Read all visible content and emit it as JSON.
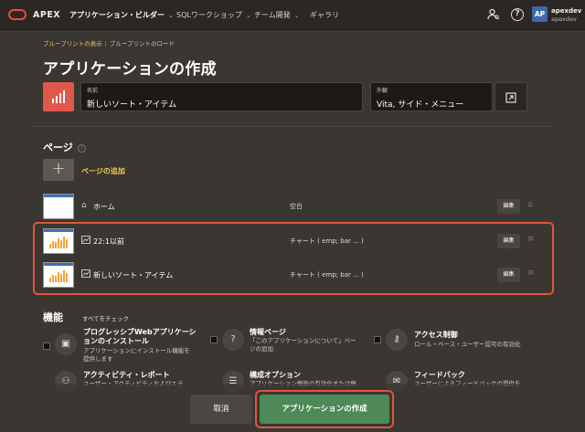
{
  "topbar": {
    "brand": "APEX",
    "nav": [
      {
        "label": "アプリケーション・ビルダー",
        "active": true
      },
      {
        "label": "SQLワークショップ",
        "active": false
      },
      {
        "label": "チーム開発",
        "active": false
      },
      {
        "label": "ギャラリ",
        "active": false
      }
    ],
    "user": {
      "initials": "AP",
      "name": "apexdev",
      "workspace": "apexdev"
    }
  },
  "breadcrumb": {
    "link": "ブループリントの表示",
    "current": "ブループリントのロード"
  },
  "page_title": "アプリケーションの作成",
  "name_field": {
    "label": "名前",
    "value": "新しいソート・アイテム"
  },
  "appearance_field": {
    "label": "外観",
    "value": "Vita, サイド・メニュー"
  },
  "pages": {
    "title": "ページ",
    "add_label": "ページの追加",
    "rows": [
      {
        "icon": "home-icon",
        "name": "ホーム",
        "type": "空白",
        "edit": "編集"
      },
      {
        "icon": "chart-icon",
        "name": "22:1以前",
        "type": "チャート ( emp; bar ... )",
        "edit": "編集"
      },
      {
        "icon": "chart-icon",
        "name": "新しいソート・アイテム",
        "type": "チャート ( emp; bar ... )",
        "edit": "編集"
      }
    ]
  },
  "features": {
    "title": "機能",
    "check_all": "すべてをチェック",
    "items": [
      {
        "title1": "プログレッシブWebアプリケーシ",
        "title2": "ョンのインストール",
        "desc1": "アプリケーションにインストール機能を",
        "desc2": "提供します"
      },
      {
        "title1": "情報ページ",
        "title2": "",
        "desc1": "「このアプリケーションについて」ペー",
        "desc2": "ジの追加"
      },
      {
        "title1": "アクセス制御",
        "title2": "",
        "desc1": "ロール・ベース・ユーザー認可の有効化",
        "desc2": ""
      },
      {
        "title1": "アクティビティ・レポート",
        "title2": "",
        "desc1": "ユーザー・アクティビティおよびエラ",
        "desc2": ""
      },
      {
        "title1": "構成オプション",
        "title2": "",
        "desc1": "アプリケーション機能の有効化または無",
        "desc2": ""
      },
      {
        "title1": "フィードバック",
        "title2": "",
        "desc1": "ユーザーによるフィードバックの提供を",
        "desc2": ""
      }
    ]
  },
  "footer": {
    "cancel": "取消",
    "create": "アプリケーションの作成"
  }
}
